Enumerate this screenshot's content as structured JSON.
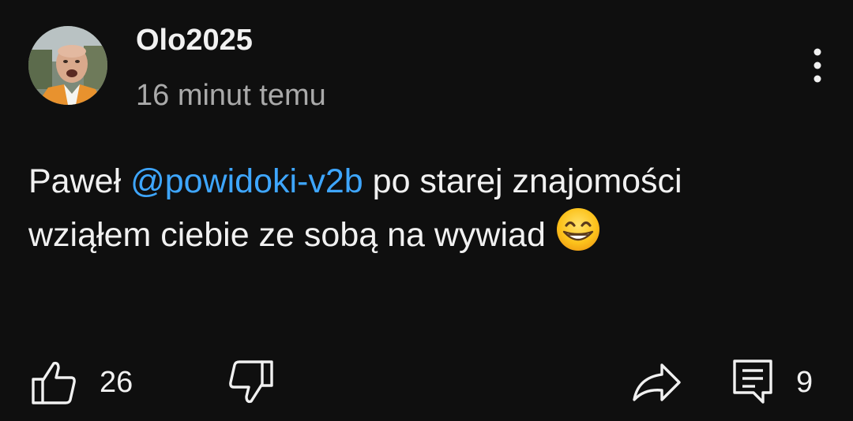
{
  "comment": {
    "author": "Olo2025",
    "timestamp": "16 minut temu",
    "text_before": "Paweł ",
    "mention": "@powidoki-v2b",
    "text_after": " po starej znajomości wziąłem ciebie ze sobą na wywiad ",
    "emoji": "grinning-face-with-smiling-eyes",
    "like_count": "26",
    "reply_count": "9"
  },
  "icons": {
    "menu": "more-vertical-icon",
    "like": "thumbs-up-icon",
    "dislike": "thumbs-down-icon",
    "share": "share-arrow-icon",
    "reply": "reply-comment-icon"
  },
  "colors": {
    "background": "#0f0f0f",
    "text": "#f1f1f1",
    "secondary_text": "#aaaaaa",
    "mention": "#3ea6ff"
  }
}
